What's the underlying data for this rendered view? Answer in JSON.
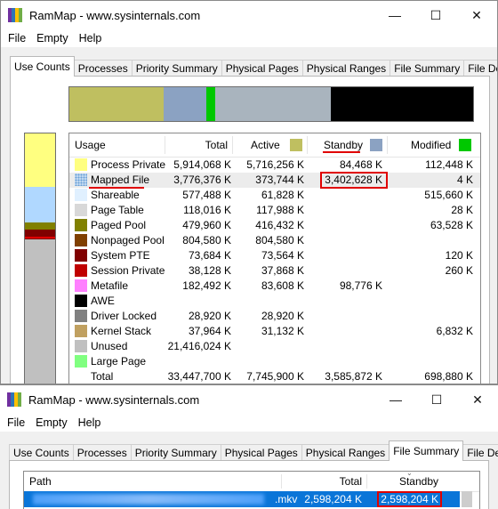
{
  "window1": {
    "title": "RamMap - www.sysinternals.com",
    "menu": [
      "File",
      "Empty",
      "Help"
    ],
    "tabs": [
      "Use Counts",
      "Processes",
      "Priority Summary",
      "Physical Pages",
      "Physical Ranges",
      "File Summary",
      "File Details"
    ],
    "active_tab": "Use Counts",
    "columns": [
      "Usage",
      "Total",
      "Active",
      "Standby",
      "Modified"
    ],
    "column_colors": {
      "active": "#bfbf60",
      "standby": "#8ba2c2",
      "modified": "#00c800"
    },
    "bar_colors": [
      "#bfbf60",
      "#8ba2c2",
      "#00c800",
      "#a9b4be",
      "#000000"
    ],
    "sidebar_colors": [
      "#ffff80",
      "#b0d8ff",
      "#808000",
      "#800000",
      "#c0c0c0"
    ],
    "rows": [
      {
        "usage": "Process Private",
        "color": "#ffff80",
        "total": "5,914,068 K",
        "active": "5,716,256 K",
        "standby": "84,468 K",
        "modified": "112,448 K"
      },
      {
        "usage": "Mapped File",
        "color": "#c0d8f0",
        "total": "3,776,376 K",
        "active": "373,744 K",
        "standby": "3,402,628 K",
        "modified": "4 K"
      },
      {
        "usage": "Shareable",
        "color": "#e0f0ff",
        "total": "577,488 K",
        "active": "61,828 K",
        "standby": "",
        "modified": "515,660 K"
      },
      {
        "usage": "Page Table",
        "color": "#d8d8d8",
        "total": "118,016 K",
        "active": "117,988 K",
        "standby": "",
        "modified": "28 K"
      },
      {
        "usage": "Paged Pool",
        "color": "#808000",
        "total": "479,960 K",
        "active": "416,432 K",
        "standby": "",
        "modified": "63,528 K"
      },
      {
        "usage": "Nonpaged Pool",
        "color": "#804000",
        "total": "804,580 K",
        "active": "804,580 K",
        "standby": "",
        "modified": ""
      },
      {
        "usage": "System PTE",
        "color": "#800000",
        "total": "73,684 K",
        "active": "73,564 K",
        "standby": "",
        "modified": "120 K"
      },
      {
        "usage": "Session Private",
        "color": "#c00000",
        "total": "38,128 K",
        "active": "37,868 K",
        "standby": "",
        "modified": "260 K"
      },
      {
        "usage": "Metafile",
        "color": "#ff80ff",
        "total": "182,492 K",
        "active": "83,608 K",
        "standby": "98,776 K",
        "modified": ""
      },
      {
        "usage": "AWE",
        "color": "#000000",
        "total": "",
        "active": "",
        "standby": "",
        "modified": ""
      },
      {
        "usage": "Driver Locked",
        "color": "#808080",
        "total": "28,920 K",
        "active": "28,920 K",
        "standby": "",
        "modified": ""
      },
      {
        "usage": "Kernel Stack",
        "color": "#c0a060",
        "total": "37,964 K",
        "active": "31,132 K",
        "standby": "",
        "modified": "6,832 K"
      },
      {
        "usage": "Unused",
        "color": "#c0c0c0",
        "total": "21,416,024 K",
        "active": "",
        "standby": "",
        "modified": ""
      },
      {
        "usage": "Large Page",
        "color": "#80ff80",
        "total": "",
        "active": "",
        "standby": "",
        "modified": ""
      },
      {
        "usage": "Total",
        "color": "",
        "total": "33,447,700 K",
        "active": "7,745,900 K",
        "standby": "3,585,872 K",
        "modified": "698,880 K"
      }
    ]
  },
  "window2": {
    "title": "RamMap - www.sysinternals.com",
    "menu": [
      "File",
      "Empty",
      "Help"
    ],
    "tabs": [
      "Use Counts",
      "Processes",
      "Priority Summary",
      "Physical Pages",
      "Physical Ranges",
      "File Summary",
      "File Details"
    ],
    "active_tab": "File Summary",
    "columns": [
      "Path",
      "Total",
      "Standby"
    ],
    "row": {
      "path_suffix": ".mkv",
      "total": "2,598,204 K",
      "standby": "2,598,204 K"
    }
  }
}
